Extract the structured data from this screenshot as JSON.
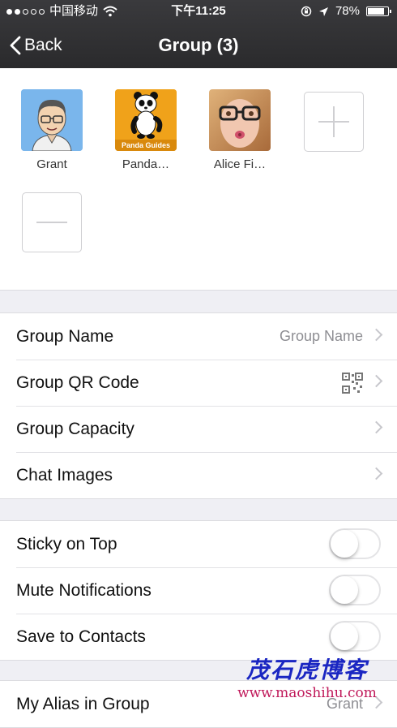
{
  "status_bar": {
    "carrier": "中国移动",
    "time": "下午11:25",
    "battery": "78%",
    "battery_level": 0.78
  },
  "nav": {
    "back_label": "Back",
    "title": "Group (3)"
  },
  "members": [
    {
      "name": "Grant"
    },
    {
      "name": "Panda…"
    },
    {
      "name": "Alice Fi…"
    }
  ],
  "panda_badge": "Panda Guides",
  "settings_section_1": [
    {
      "label": "Group Name",
      "value": "Group Name"
    },
    {
      "label": "Group QR Code"
    },
    {
      "label": "Group Capacity"
    },
    {
      "label": "Chat Images"
    }
  ],
  "settings_section_2": [
    {
      "label": "Sticky on Top",
      "on": false
    },
    {
      "label": "Mute Notifications",
      "on": false
    },
    {
      "label": "Save to Contacts",
      "on": false
    }
  ],
  "settings_section_3": [
    {
      "label": "My Alias in Group",
      "value": "Grant"
    }
  ],
  "watermark": {
    "chinese": "茂石虎博客",
    "url": "www.maoshihu.com"
  },
  "colors": {
    "nav_bg": "#2f2f31",
    "page_bg": "#efeff4",
    "accent_orange": "#f0a21a"
  }
}
